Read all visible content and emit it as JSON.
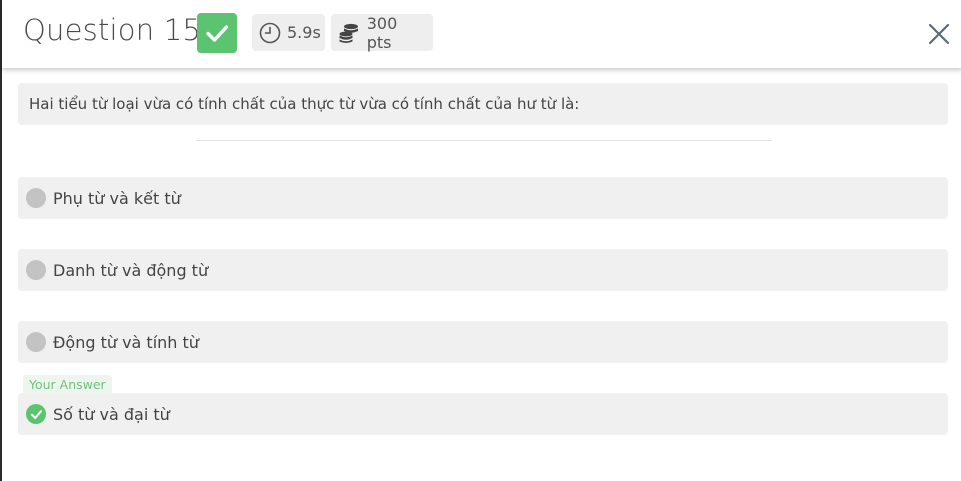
{
  "header": {
    "title": "Question 15",
    "status_icon": "check-icon",
    "time_label": "5.9s",
    "time_icon": "clock-icon",
    "points_label": "300 pts",
    "points_icon": "coins-icon",
    "close_icon": "close-icon"
  },
  "question": {
    "text": "Hai tiểu từ loại vừa có tính chất của thực từ vừa có tính chất của hư từ là:"
  },
  "options": [
    {
      "label": "Phụ từ và kết từ",
      "selected": false
    },
    {
      "label": "Danh từ và động từ",
      "selected": false
    },
    {
      "label": "Động từ và tính từ",
      "selected": false
    },
    {
      "label": "Số từ và đại từ",
      "selected": true
    }
  ],
  "your_answer_tag": "Your Answer",
  "colors": {
    "correct": "#5cc370",
    "option_bg": "#f0f0f0",
    "chip_bg": "#eeeeee",
    "radio_idle": "#c3c3c3"
  }
}
